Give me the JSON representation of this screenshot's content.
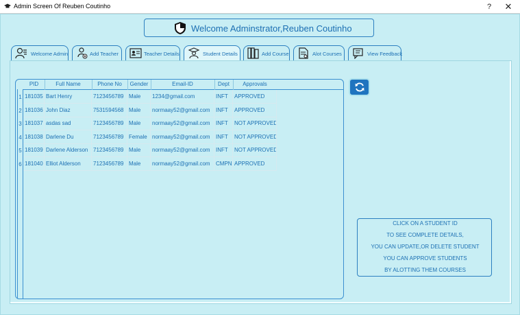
{
  "window": {
    "title": "Admin Screen Of Reuben Coutinho",
    "help_label": "?",
    "close_label": "✕"
  },
  "welcome": {
    "text": "Welcome Adminstrator,Reuben Coutinho"
  },
  "tabs": [
    {
      "label": "Welcome Admin",
      "icon": "admin-icon"
    },
    {
      "label": "Add Teacher",
      "icon": "teacher-add-icon"
    },
    {
      "label": "Teacher Details",
      "icon": "teacher-details-icon"
    },
    {
      "label": "Student Details",
      "icon": "student-icon",
      "active": true
    },
    {
      "label": "Add Course",
      "icon": "books-icon"
    },
    {
      "label": "Alot Courses",
      "icon": "document-icon"
    },
    {
      "label": "View Feedback",
      "icon": "feedback-icon"
    }
  ],
  "table": {
    "columns": [
      "PID",
      "Full Name",
      "Phone No",
      "Gender",
      "Email-ID",
      "Dept",
      "Approvals"
    ],
    "rows": [
      {
        "num": "1",
        "pid": "181035",
        "name": "Bart Henry",
        "phone": "7123456789",
        "gender": "Male",
        "email": "1234@gmail.com",
        "dept": "INFT",
        "approval": "APPROVED"
      },
      {
        "num": "2",
        "pid": "181036",
        "name": "John Diaz",
        "phone": "7531594568",
        "gender": "Male",
        "email": "normaay52@gmail.com",
        "dept": "INFT",
        "approval": "APPROVED"
      },
      {
        "num": "3",
        "pid": "181037",
        "name": "asdas sad",
        "phone": "7123456789",
        "gender": "Male",
        "email": "normaay52@gmail.com",
        "dept": "INFT",
        "approval": "NOT APPROVED"
      },
      {
        "num": "4",
        "pid": "181038",
        "name": "Darlene Du",
        "phone": "7123456789",
        "gender": "Female",
        "email": "normaay52@gmail.com",
        "dept": "INFT",
        "approval": "NOT APPROVED"
      },
      {
        "num": "5",
        "pid": "181039",
        "name": "Darlene Alderson",
        "phone": "7123456789",
        "gender": "Male",
        "email": "normaay52@gmail.com",
        "dept": "INFT",
        "approval": "NOT APPROVED"
      },
      {
        "num": "6",
        "pid": "181040",
        "name": "Elliot Alderson",
        "phone": "7123456789",
        "gender": "Male",
        "email": "normaay52@gmail.com",
        "dept": "CMPN",
        "approval": "APPROVED"
      }
    ]
  },
  "refresh": {
    "icon": "refresh-icon"
  },
  "info": {
    "lines": [
      "CLICK ON A STUDENT ID",
      "TO SEE COMPLETE DETAILS,",
      "YOU CAN UPDATE,OR DELETE STUDENT",
      "YOU CAN APPROVE STUDENTS",
      "BY ALOTTING THEM COURSES"
    ]
  },
  "colors": {
    "accent": "#1b6fb3",
    "background": "#c8eef4",
    "button": "#1f74bf"
  }
}
